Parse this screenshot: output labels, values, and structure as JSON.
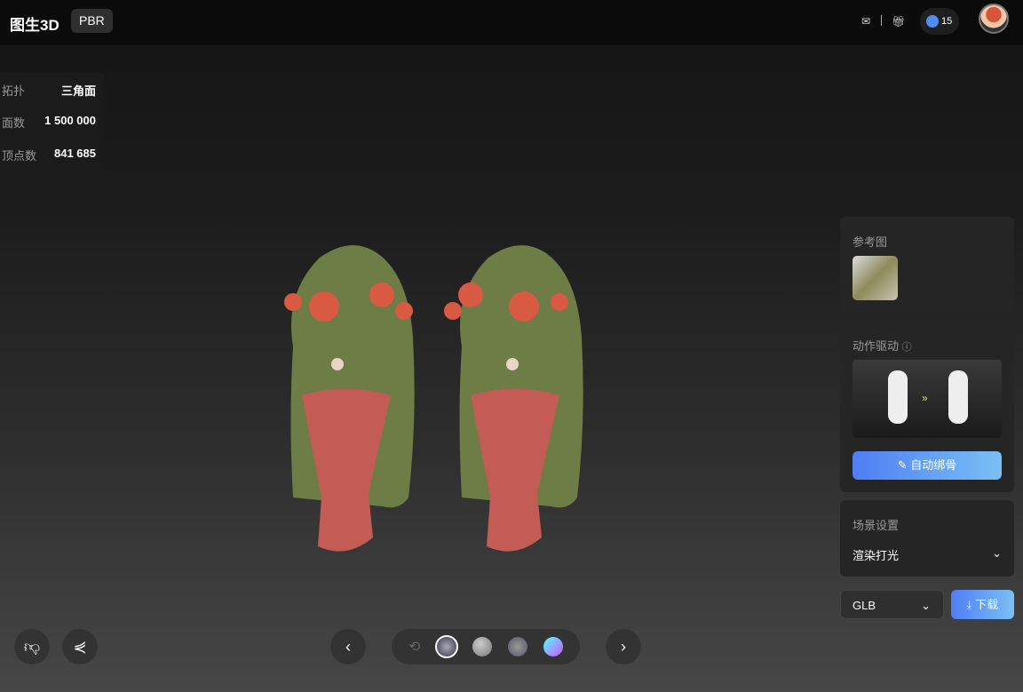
{
  "header": {
    "title": "图生3D",
    "badge": "PBR",
    "credits": "15"
  },
  "stats": [
    {
      "label": "拓扑",
      "value": "三角面"
    },
    {
      "label": "面数",
      "value": "1 500 000"
    },
    {
      "label": "顶点数",
      "value": "841 685"
    }
  ],
  "reference": {
    "title": "参考图"
  },
  "motion": {
    "title": "动作驱动",
    "button": "自动绑骨"
  },
  "scene": {
    "title": "场景设置",
    "select": "渲染打光"
  },
  "export": {
    "format": "GLB",
    "download": "下载"
  },
  "colors": {
    "accent": "#5b8cf7"
  }
}
